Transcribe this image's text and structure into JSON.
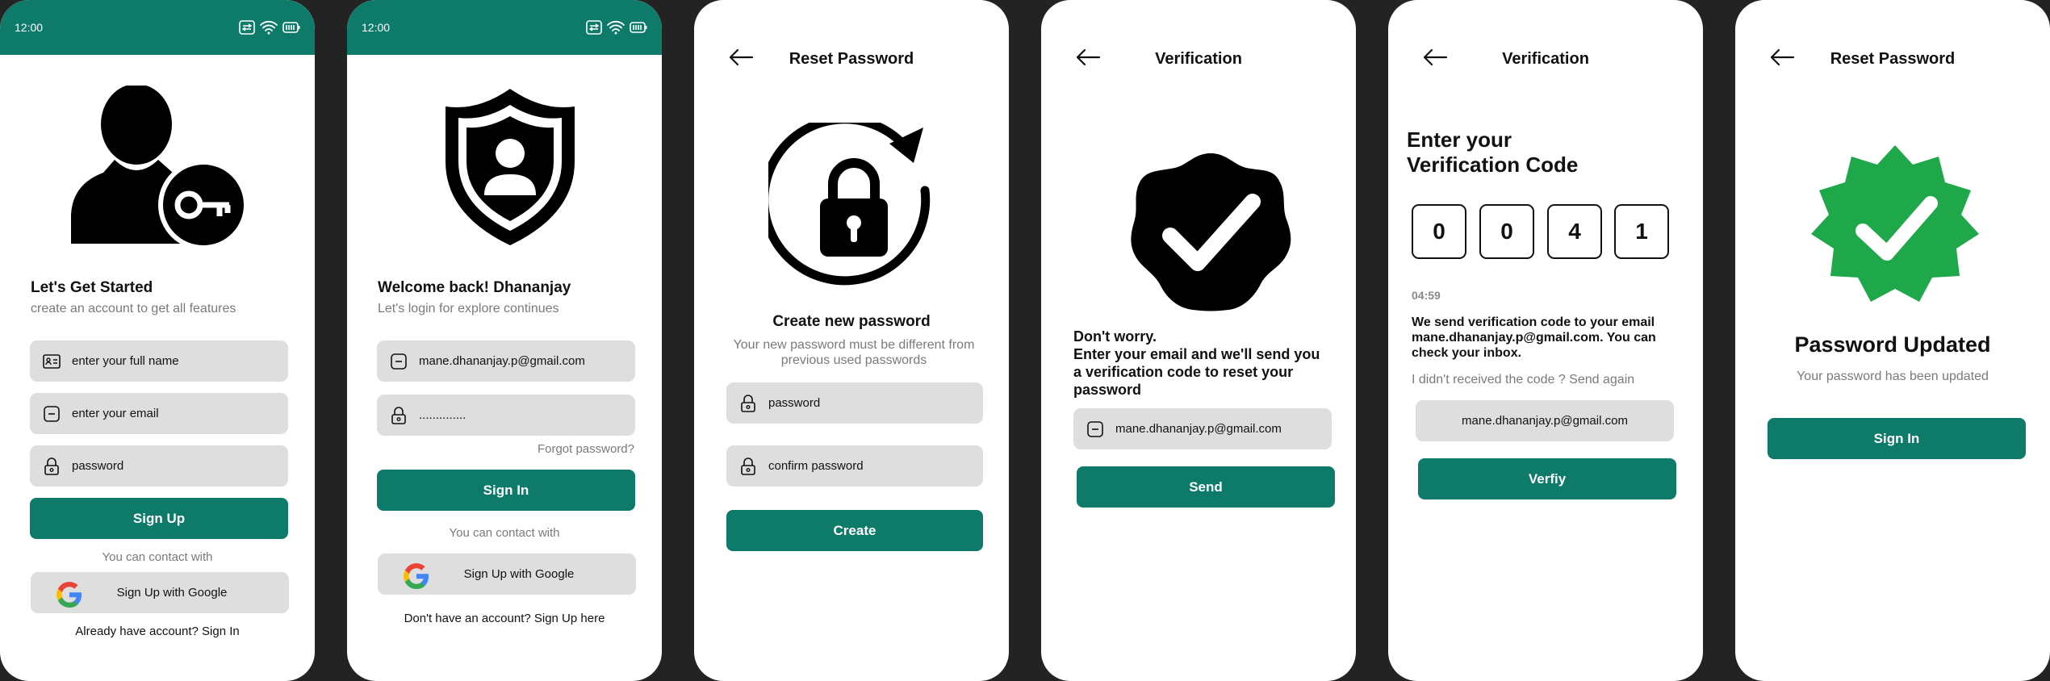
{
  "status": {
    "time": "12:00"
  },
  "screen1": {
    "title": "Let's Get Started",
    "subtitle": "create an account to get all features",
    "fields": [
      "enter your full name",
      "enter your email",
      "password"
    ],
    "primary_button": "Sign Up",
    "contact_text": "You can contact with",
    "google_button": "Sign Up with Google",
    "footer_text": "Already have account? Sign In"
  },
  "screen2": {
    "title": "Welcome back! Dhananjay",
    "subtitle": "Let's login for explore continues",
    "email_value": "mane.dhananjay.p@gmail.com",
    "password_value": "..............",
    "forgot": "Forgot password?",
    "primary_button": "Sign In",
    "contact_text": "You can contact with",
    "google_button": "Sign Up with Google",
    "footer_text": "Don't have an account? Sign Up here"
  },
  "screen3": {
    "header": "Reset Password",
    "title": "Create new password",
    "subtitle": "Your new password must be different from previous used passwords",
    "fields": [
      "password",
      "confirm password"
    ],
    "primary_button": "Create"
  },
  "screen4": {
    "header": "Verification",
    "message_line1": "Don't worry.",
    "message_line2": "Enter your email and we'll send you a verification code to reset your password",
    "email_value": "mane.dhananjay.p@gmail.com",
    "primary_button": "Send"
  },
  "screen5": {
    "header": "Verification",
    "title_line1": "Enter your",
    "title_line2": "Verification Code",
    "digits": [
      "0",
      "0",
      "4",
      "1"
    ],
    "timer": "04:59",
    "info": "We send verification code to your email mane.dhananjay.p@gmail.com. You can check your inbox.",
    "resend": "I didn't received the code ? Send again",
    "email_value": "mane.dhananjay.p@gmail.com",
    "primary_button": "Verfiy"
  },
  "screen6": {
    "header": "Reset Password",
    "title": "Password Updated",
    "subtitle": "Your password has been updated",
    "primary_button": "Sign In"
  },
  "colors": {
    "accent": "#0d7a6a",
    "success": "#1ea84a",
    "field": "#dedede",
    "backdrop": "#232323"
  }
}
